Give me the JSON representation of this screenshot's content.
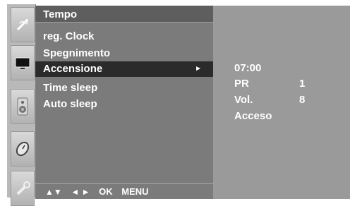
{
  "menu": {
    "title": "Tempo",
    "items": [
      {
        "label": "reg. Clock"
      },
      {
        "label": "Spegnimento"
      },
      {
        "label": "Accensione",
        "selected": true
      },
      {
        "label": "Time sleep"
      },
      {
        "label": "Auto sleep"
      }
    ],
    "arrow": "►"
  },
  "footer": {
    "nav_up_down": "▲▼",
    "nav_left_right": "◄ ►",
    "ok": "OK",
    "menu": "MENU"
  },
  "submenu": {
    "time": "07:00",
    "pr_label": "PR",
    "pr_value": "1",
    "vol_label": "Vol.",
    "vol_value": "8",
    "state": "Acceso"
  },
  "icons": [
    "satellite-dish-icon",
    "tv-screen-icon",
    "speaker-icon",
    "clock-icon",
    "wrench-icon"
  ],
  "colors": {
    "menu_bg": "#7b7b7b",
    "title_bg": "#5e5e5e",
    "selected_bg": "#2b2b2b",
    "submenu_bg": "#9a9a9a",
    "icon_column_bg": "#b9b9b9"
  }
}
